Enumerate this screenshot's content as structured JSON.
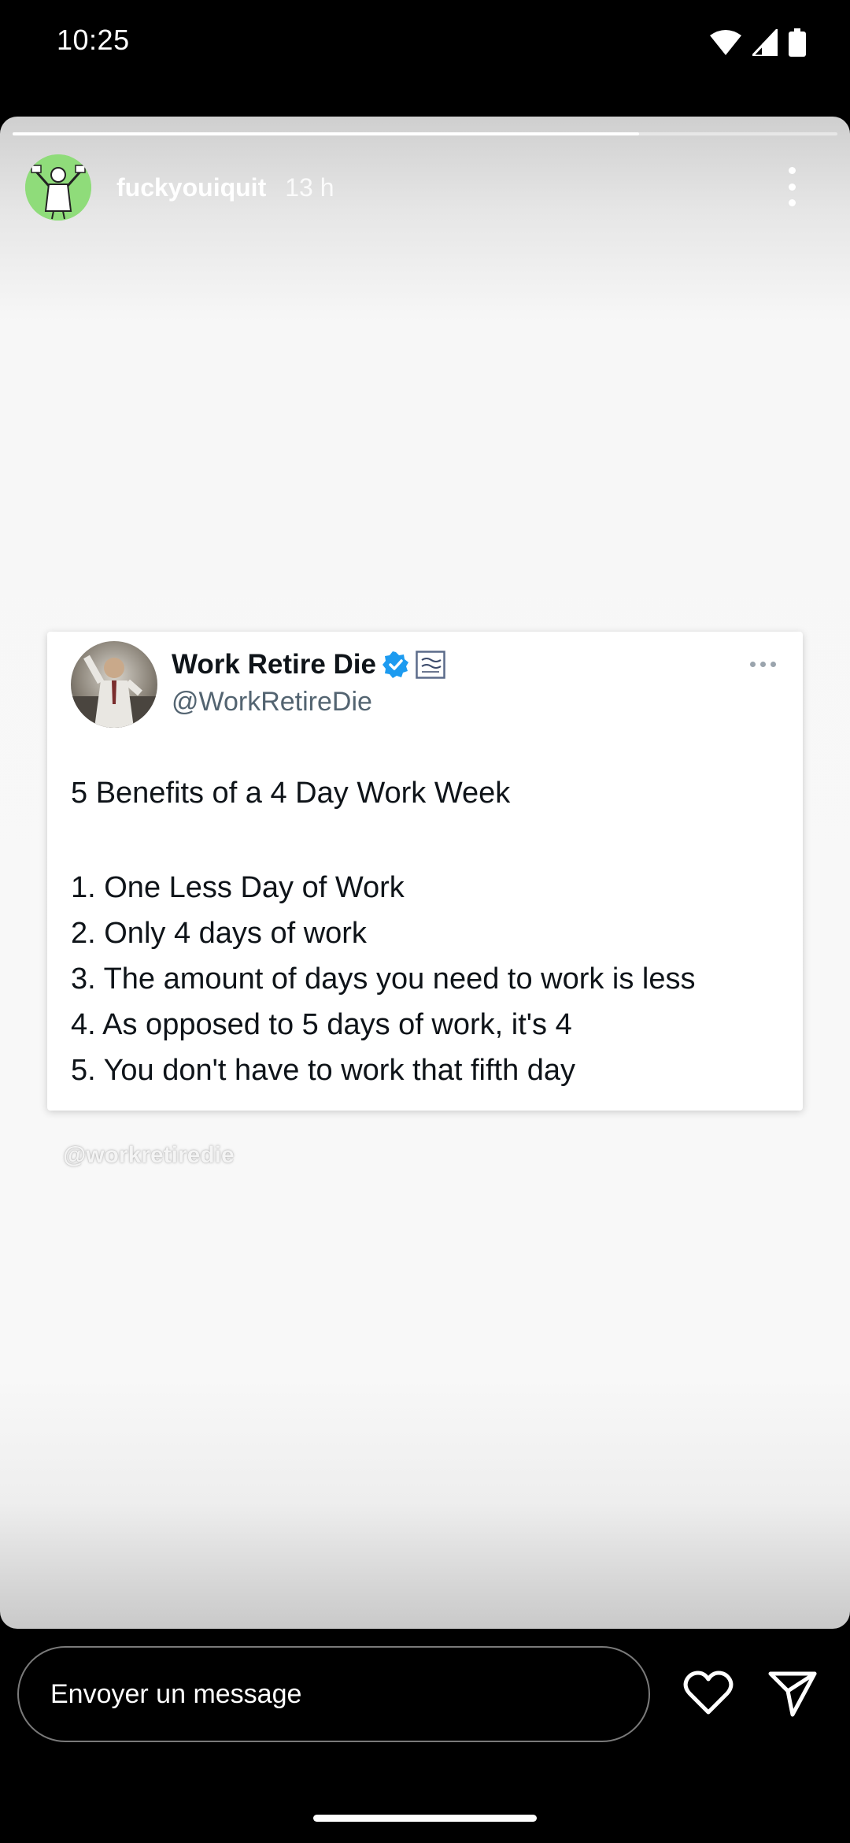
{
  "status_bar": {
    "time": "10:25",
    "icons": [
      "wifi-icon",
      "signal-icon",
      "battery-icon"
    ]
  },
  "story": {
    "progress_fraction": 0.76,
    "username": "fuckyouiquit",
    "timestamp": "13 h",
    "menu_icon": "more-vertical-icon"
  },
  "tweet": {
    "name": "Work Retire Die",
    "handle": "@WorkRetireDie",
    "title": "5 Benefits of a 4 Day Work Week",
    "items": [
      "1. One Less Day of Work",
      "2. Only 4 days of work",
      "3. The amount of days you need to work is less",
      "4. As opposed to 5 days of work, it's 4",
      "5. You don't have to work that fifth day"
    ],
    "verified_color": "#1d9bf0"
  },
  "watermark": "@workretiredie",
  "bottom_bar": {
    "message_placeholder": "Envoyer un message",
    "icons": [
      "heart-icon",
      "send-icon"
    ]
  }
}
